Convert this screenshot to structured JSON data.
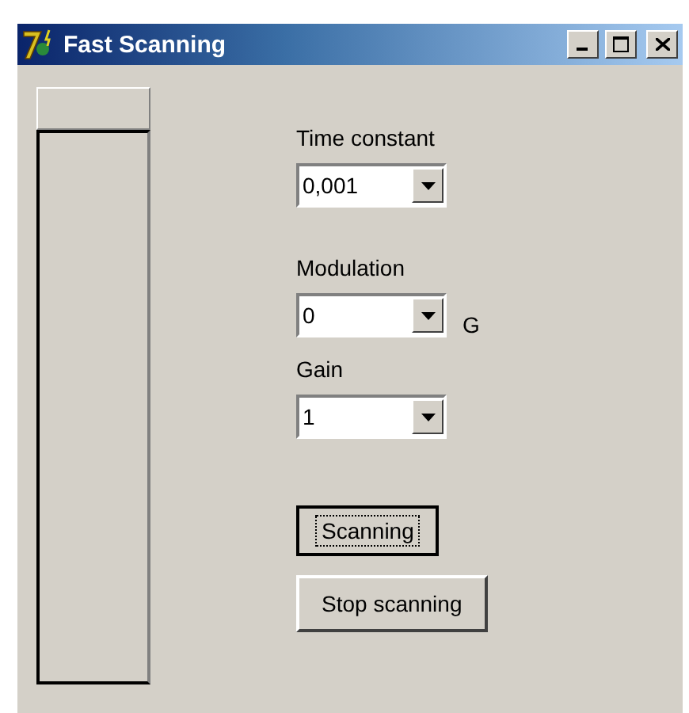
{
  "window": {
    "title": "Fast Scanning"
  },
  "fields": [
    {
      "label": "Time constant",
      "value": "0,001"
    },
    {
      "label": "Modulation",
      "value": "0",
      "unit": "G"
    },
    {
      "label": "Gain",
      "value": "1"
    }
  ],
  "buttons": [
    {
      "label": "Scanning",
      "focused": true
    },
    {
      "label": "Stop scanning",
      "focused": false
    }
  ]
}
